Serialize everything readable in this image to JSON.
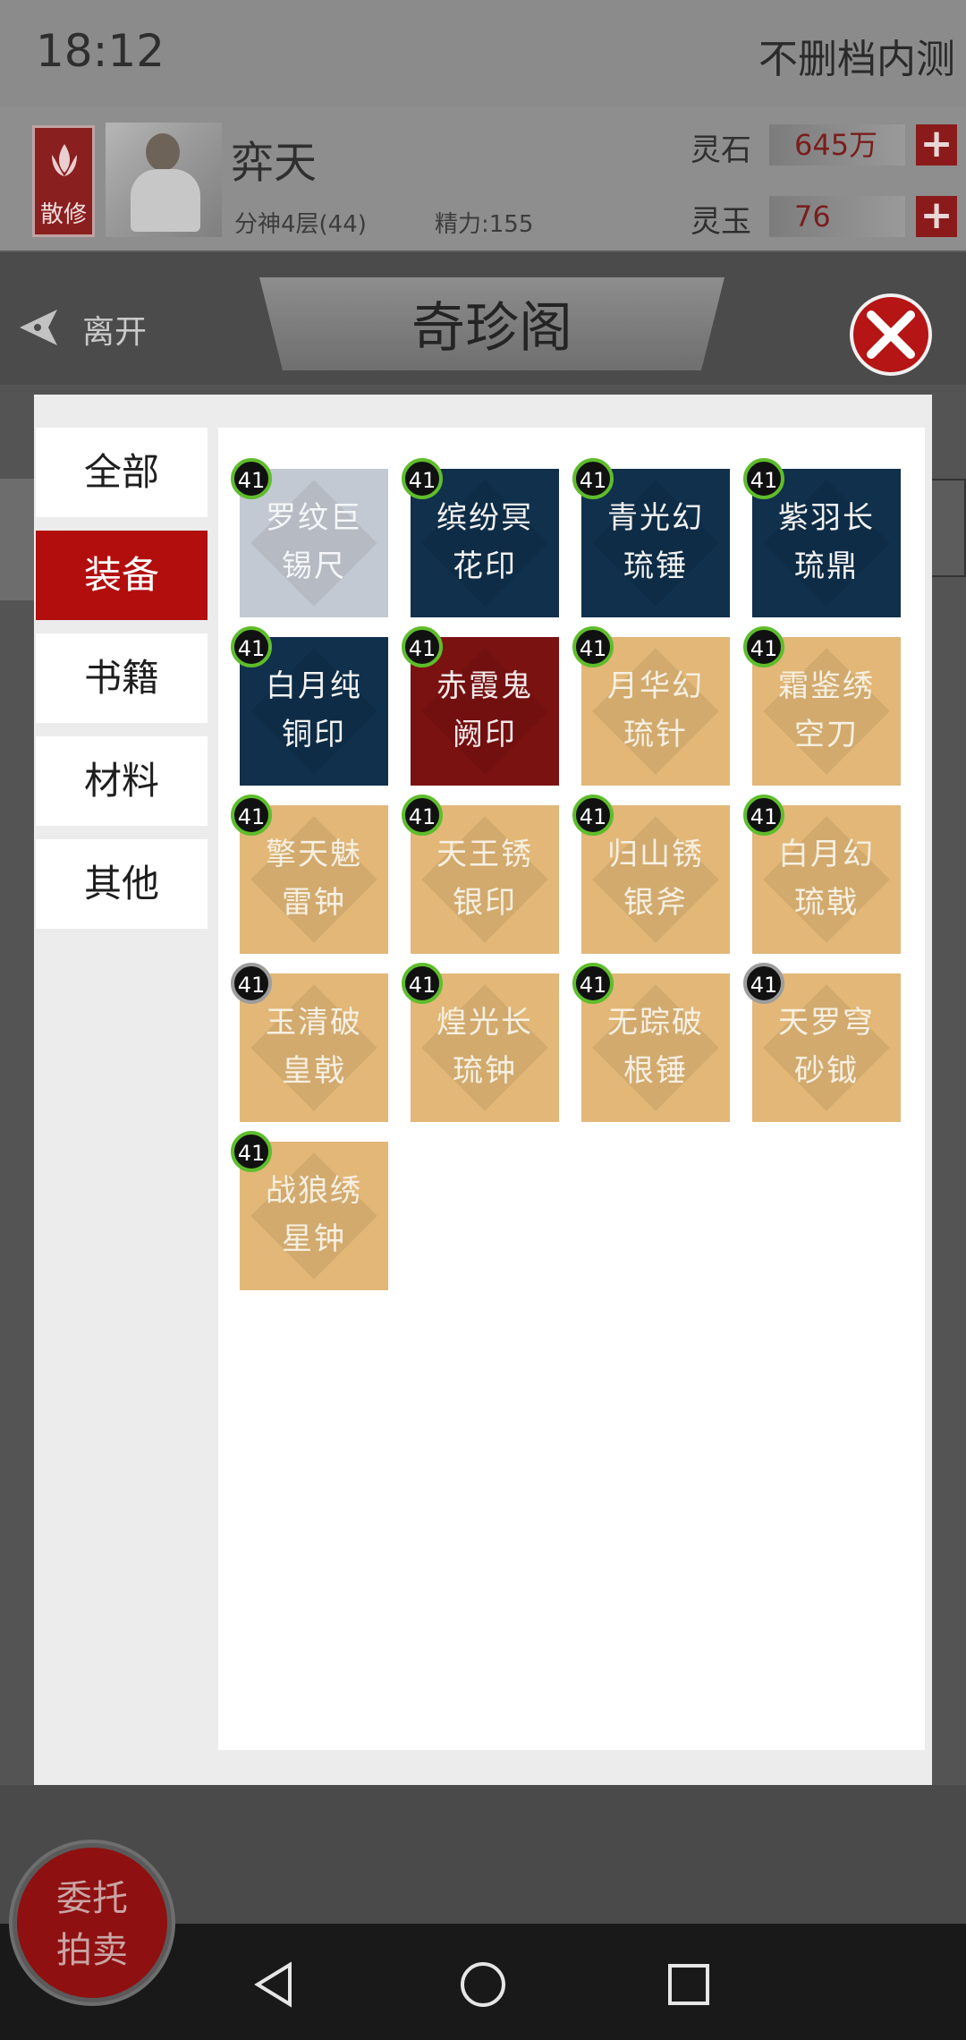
{
  "status_bar": {
    "time": "18:12",
    "top_right": "不删档内测"
  },
  "character": {
    "sect": "散修",
    "name": "弈天",
    "realm": "分神4层(44)",
    "energy": "精力:155"
  },
  "resources": [
    {
      "label": "灵石",
      "value": "645万"
    },
    {
      "label": "灵玉",
      "value": "76"
    }
  ],
  "nav": {
    "leave": "离开",
    "title": "奇珍阁"
  },
  "tabs": [
    "全部",
    "装备",
    "书籍",
    "材料",
    "其他"
  ],
  "active_tab": "装备",
  "items": [
    {
      "name1": "罗纹巨",
      "name2": "锡尺",
      "level": "41",
      "tier": "gray",
      "badge": "green"
    },
    {
      "name1": "缤纷冥",
      "name2": "花印",
      "level": "41",
      "tier": "navy",
      "badge": "green"
    },
    {
      "name1": "青光幻",
      "name2": "琉锤",
      "level": "41",
      "tier": "navy",
      "badge": "green"
    },
    {
      "name1": "紫羽长",
      "name2": "琉鼎",
      "level": "41",
      "tier": "navy",
      "badge": "green"
    },
    {
      "name1": "白月纯",
      "name2": "铜印",
      "level": "41",
      "tier": "navy",
      "badge": "green"
    },
    {
      "name1": "赤霞鬼",
      "name2": "阙印",
      "level": "41",
      "tier": "red",
      "badge": "green"
    },
    {
      "name1": "月华幻",
      "name2": "琉针",
      "level": "41",
      "tier": "gold",
      "badge": "green"
    },
    {
      "name1": "霜鉴绣",
      "name2": "空刀",
      "level": "41",
      "tier": "gold",
      "badge": "green"
    },
    {
      "name1": "擎天魅",
      "name2": "雷钟",
      "level": "41",
      "tier": "gold",
      "badge": "green"
    },
    {
      "name1": "天王锈",
      "name2": "银印",
      "level": "41",
      "tier": "gold",
      "badge": "green"
    },
    {
      "name1": "归山锈",
      "name2": "银斧",
      "level": "41",
      "tier": "gold",
      "badge": "green"
    },
    {
      "name1": "白月幻",
      "name2": "琉戟",
      "level": "41",
      "tier": "gold",
      "badge": "green"
    },
    {
      "name1": "玉清破",
      "name2": "皇戟",
      "level": "41",
      "tier": "gold",
      "badge": "gray"
    },
    {
      "name1": "煌光长",
      "name2": "琉钟",
      "level": "41",
      "tier": "gold",
      "badge": "green"
    },
    {
      "name1": "无踪破",
      "name2": "根锤",
      "level": "41",
      "tier": "gold",
      "badge": "green"
    },
    {
      "name1": "天罗穹",
      "name2": "砂钺",
      "level": "41",
      "tier": "gold",
      "badge": "gray"
    },
    {
      "name1": "战狼绣",
      "name2": "星钟",
      "level": "41",
      "tier": "gold",
      "badge": "green"
    }
  ],
  "auction_button": {
    "line1": "委托",
    "line2": "拍卖"
  },
  "colors": {
    "accent_red": "#b30e0e",
    "tier_gray": "#c3c9d2",
    "tier_navy": "#10304c",
    "tier_red": "#7b1212",
    "tier_gold": "#e2b777",
    "badge_green": "#5fbd2c"
  }
}
